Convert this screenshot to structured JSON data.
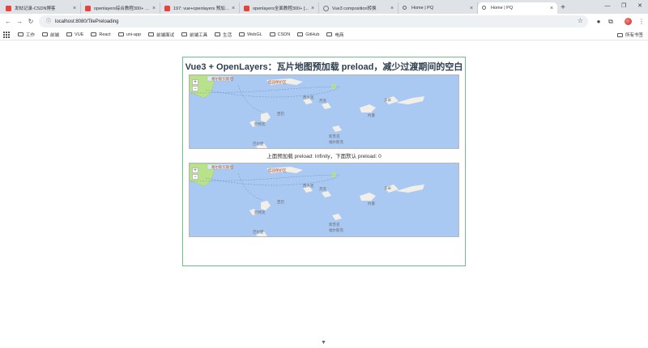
{
  "tabs": [
    {
      "title": "发帖记录-CSDN博客",
      "favicon": "csdn"
    },
    {
      "title": "openlayers综合教程300+ 还...",
      "favicon": "csdn"
    },
    {
      "title": "197: vue+openlayers 预加载...",
      "favicon": "csdn"
    },
    {
      "title": "openlayers全面教程300+ [...",
      "favicon": "csdn"
    },
    {
      "title": "Vue3 composition转换",
      "favicon": "globe"
    },
    {
      "title": "Home | PQ",
      "favicon": "search"
    },
    {
      "title": "Home | PQ",
      "favicon": "search",
      "active": true
    }
  ],
  "toolbar": {
    "url": "localhost:8080/TilePreloading"
  },
  "bookmarks": {
    "items": [
      "工作",
      "前端",
      "VUE",
      "React",
      "uni-app",
      "前端面试",
      "前端工具",
      "生活",
      "WebGL",
      "CSDN",
      "GitHub",
      "电商"
    ],
    "all_bookmarks": "所有书签"
  },
  "page": {
    "title": "Vue3 + OpenLayers：瓦片地图预加载 preload，减少过渡期间的空白区域",
    "caption": "上面预加载 preload: Infinity，下面默认 preload: 0",
    "zoom_in": "+",
    "zoom_out": "−"
  },
  "map_labels": {
    "red1": "格尔斯贝斯坦",
    "red2": "桂园保护区",
    "l1": "西巴",
    "l2": "西大克",
    "l3": "苏克",
    "l4": "约曼",
    "l5": "多米",
    "l6": "新苏克",
    "l7": "福尔斯克",
    "l8": "斯特克",
    "l9": "巴尔登"
  },
  "colors": {
    "sea": "#a9c9f3",
    "land": "#f2efe9",
    "park": "#b9e38b",
    "border_green": "#6ac38a"
  }
}
